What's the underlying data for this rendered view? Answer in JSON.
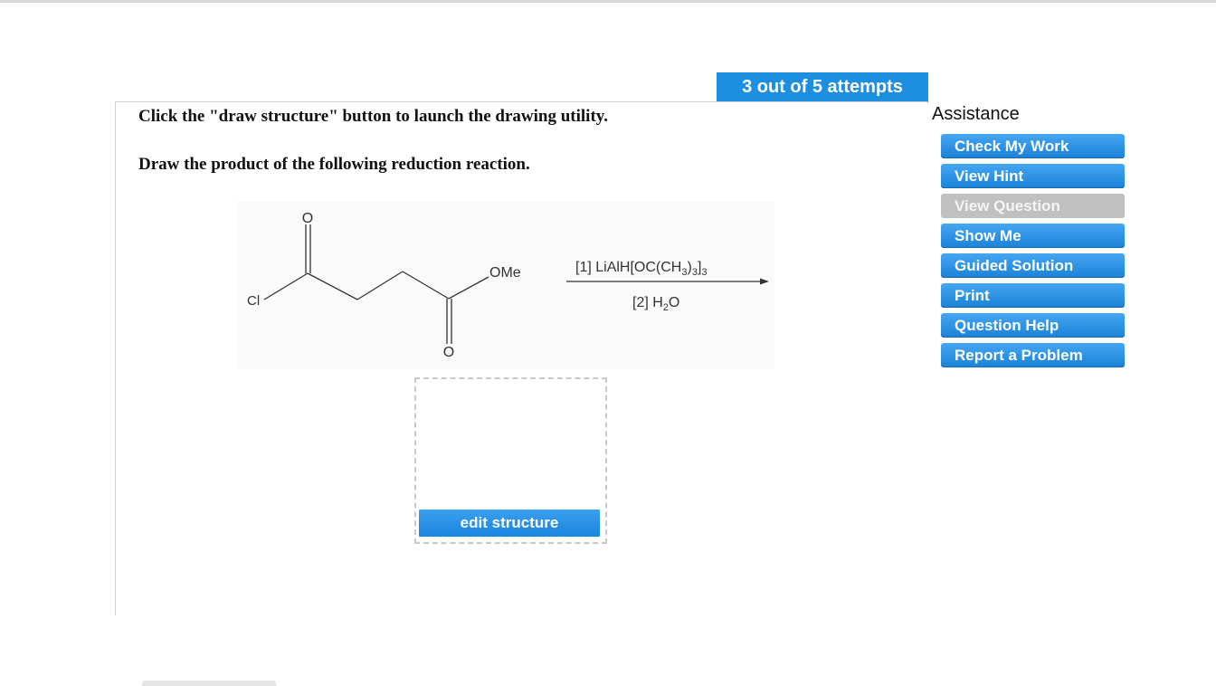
{
  "attempts_label": "3 out of 5 attempts",
  "instructions": {
    "line1": "Click the \"draw structure\" button to launch the drawing utility.",
    "line2": "Draw the product of the following reduction reaction."
  },
  "reaction": {
    "atom_O_top": "O",
    "atom_O_bottom": "O",
    "atom_Cl": "Cl",
    "group_OMe": "OMe",
    "reagent1_prefix": "[1] LiAlH[OC(CH",
    "reagent1_sub1": "3",
    "reagent1_mid": ")",
    "reagent1_sub2": "3",
    "reagent1_end": "]",
    "reagent1_sub3": "3",
    "reagent2_prefix": "[2] H",
    "reagent2_sub": "2",
    "reagent2_end": "O"
  },
  "edit_button_label": "edit structure",
  "assistance": {
    "title": "Assistance",
    "items": [
      {
        "label": "Check My Work",
        "enabled": true
      },
      {
        "label": "View Hint",
        "enabled": true
      },
      {
        "label": "View Question",
        "enabled": false
      },
      {
        "label": "Show Me",
        "enabled": true
      },
      {
        "label": "Guided Solution",
        "enabled": true
      },
      {
        "label": "Print",
        "enabled": true
      },
      {
        "label": "Question Help",
        "enabled": true
      },
      {
        "label": "Report a Problem",
        "enabled": true
      }
    ]
  },
  "colors": {
    "accent_blue": "#1e8fe0",
    "disabled_gray": "#c0c0c0"
  }
}
